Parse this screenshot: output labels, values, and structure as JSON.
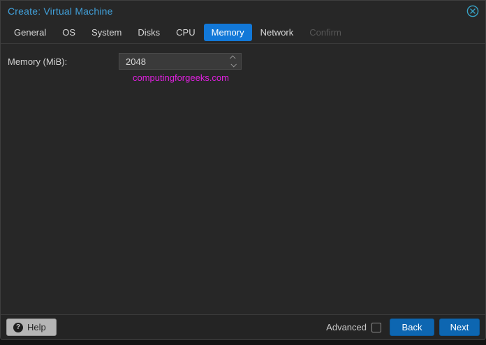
{
  "colors": {
    "dialog_background": "#272727",
    "title_accent": "#41a0da",
    "active_tab_blue": "#1278d8",
    "button_blue": "#0d66b1",
    "watermark_magenta": "#e020e0",
    "close_icon_blue": "#37a3c6"
  },
  "header": {
    "title": "Create: Virtual Machine",
    "close_icon": "circle-x-icon"
  },
  "tabs": [
    {
      "label": "General",
      "state": "normal"
    },
    {
      "label": "OS",
      "state": "normal"
    },
    {
      "label": "System",
      "state": "normal"
    },
    {
      "label": "Disks",
      "state": "normal"
    },
    {
      "label": "CPU",
      "state": "normal"
    },
    {
      "label": "Memory",
      "state": "active"
    },
    {
      "label": "Network",
      "state": "normal"
    },
    {
      "label": "Confirm",
      "state": "disabled"
    }
  ],
  "form": {
    "memory_label": "Memory (MiB):",
    "memory_value": "2048",
    "stepper_icons": [
      "chevron-up",
      "chevron-down"
    ]
  },
  "watermark": "computingforgeeks.com",
  "footer": {
    "help_label": "Help",
    "help_icon": "question-mark",
    "advanced_label": "Advanced",
    "advanced_checked": false,
    "back_label": "Back",
    "next_label": "Next"
  }
}
